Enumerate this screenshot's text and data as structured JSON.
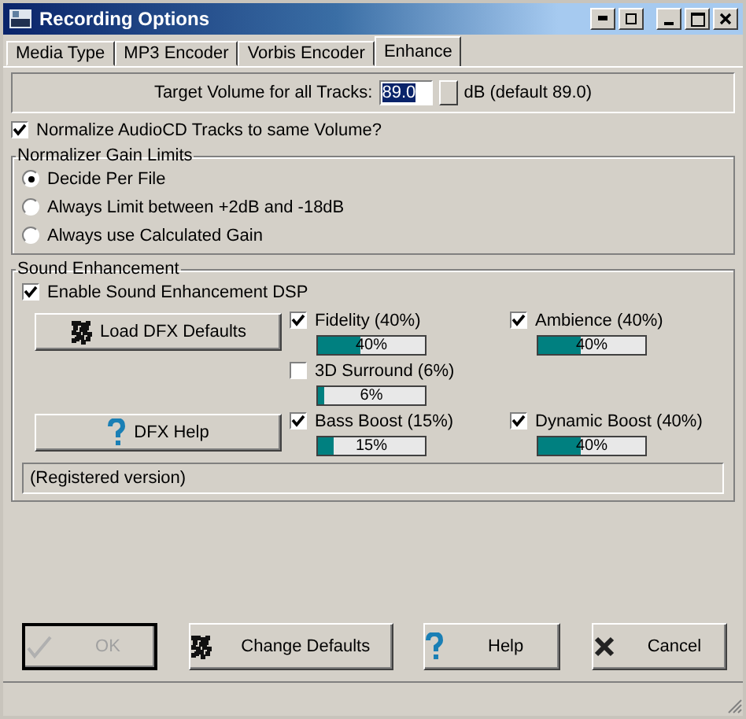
{
  "window": {
    "title": "Recording Options"
  },
  "tabs": [
    {
      "label": "Media Type",
      "selected": false
    },
    {
      "label": "MP3 Encoder",
      "selected": false
    },
    {
      "label": "Vorbis Encoder",
      "selected": false
    },
    {
      "label": "Enhance",
      "selected": true
    }
  ],
  "target_volume": {
    "label": "Target Volume for all Tracks:",
    "value": "89.0",
    "suffix": "dB (default 89.0)"
  },
  "normalize": {
    "label": "Normalize AudioCD Tracks to same Volume?",
    "checked": true
  },
  "gain_limits": {
    "title": "Normalizer Gain Limits",
    "options": [
      {
        "label": "Decide Per File",
        "selected": true
      },
      {
        "label": "Always Limit between +2dB and -18dB",
        "selected": false
      },
      {
        "label": "Always use Calculated Gain",
        "selected": false
      }
    ]
  },
  "sound_enhancement": {
    "title": "Sound Enhancement",
    "enable": {
      "label": "Enable Sound Enhancement DSP",
      "checked": true
    },
    "load_button": "Load DFX Defaults",
    "help_button": "DFX Help",
    "effect_rows": [
      [
        {
          "label": "Fidelity (40%)",
          "checked": true,
          "level": 0.4,
          "reading": "40%"
        },
        {
          "label": "Ambience (40%)",
          "checked": true,
          "level": 0.4,
          "reading": "40%"
        }
      ],
      [
        {
          "label": "3D Surround (6%)",
          "checked": false,
          "level": 0.06,
          "reading": "6%"
        }
      ],
      [
        {
          "label": "Bass Boost (15%)",
          "checked": true,
          "level": 0.15,
          "reading": "15%"
        },
        {
          "label": "Dynamic Boost (40%)",
          "checked": true,
          "level": 0.4,
          "reading": "40%"
        }
      ]
    ],
    "status": "(Registered version)"
  },
  "buttons": [
    {
      "label": "OK",
      "kind": "ok",
      "disabled": true
    },
    {
      "label": "Change Defaults",
      "kind": "defaults",
      "disabled": false
    },
    {
      "label": "Help",
      "kind": "help",
      "disabled": false
    },
    {
      "label": "Cancel",
      "kind": "cancel",
      "disabled": false
    }
  ]
}
